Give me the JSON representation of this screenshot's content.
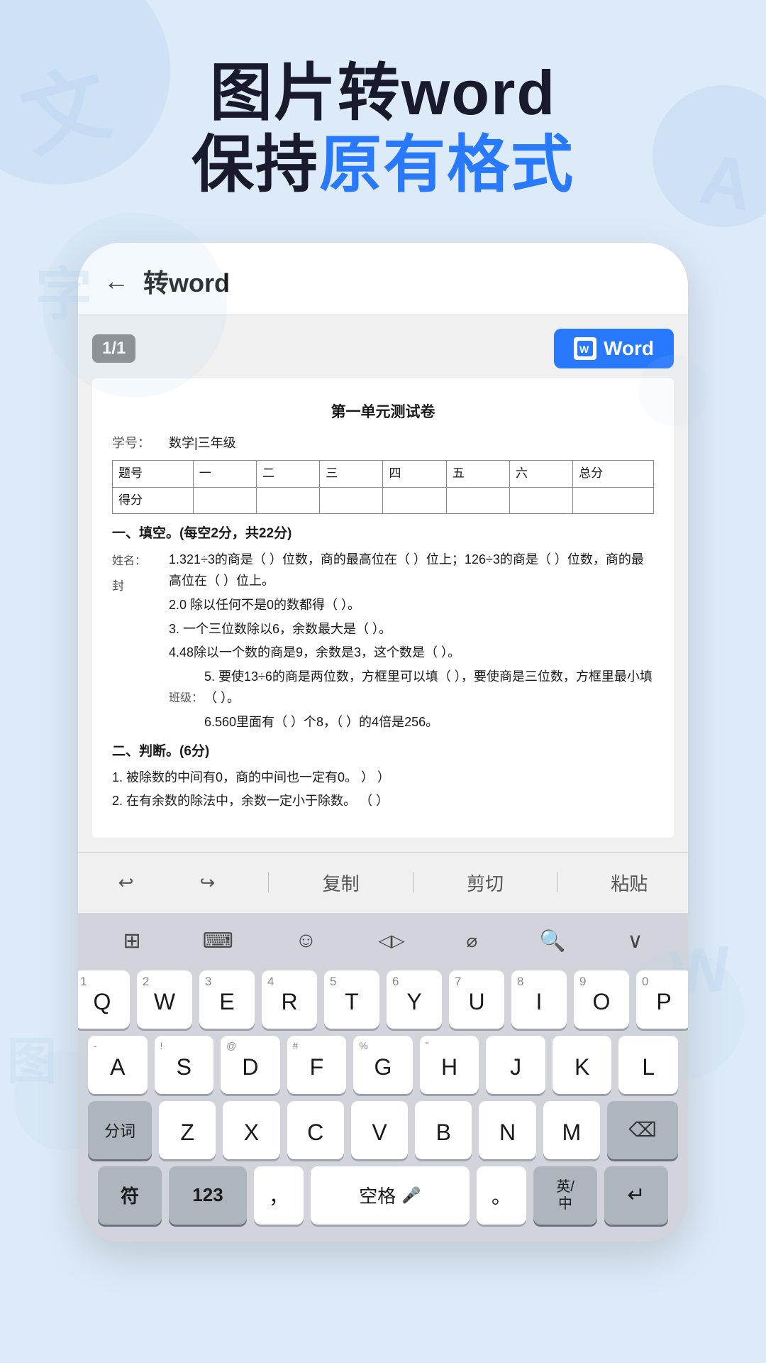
{
  "header": {
    "line1": "图片转word",
    "line2_prefix": "保持",
    "line2_blue": "原有格式",
    "line2_suffix": ""
  },
  "app": {
    "back_label": "←",
    "title": "转word",
    "page_indicator": "1/1",
    "word_button_label": "Word"
  },
  "document": {
    "title": "第一单元测试卷",
    "info_xue_hao": "数学|三年级",
    "table_headers": [
      "题号",
      "一",
      "二",
      "三",
      "四",
      "五",
      "六",
      "总分"
    ],
    "table_row2": [
      "得分",
      "",
      "",
      "",
      "",
      "",
      "",
      ""
    ],
    "section1_title": "一、填空。(每空2分，共22分)",
    "q1": "1.321÷3的商是（ ）位数，商的最高位在（ ）位上；126÷3的商是（ ）位数，商的最高位在（ ）位上。",
    "q2": "2.0 除以任何不是0的数都得（ ）。",
    "q3": "3. 一个三位数除以6，余数最大是（ ）。",
    "q4": "4.48除以一个数的商是9，余数是3，这个数是（ ）。",
    "q5": "5. 要使13÷6的商是两位数，方框里可以填（ ），要使商是三位数，方框里最小填（ ）。",
    "q6": "6.560里面有（ ）个8，（ ）的4倍是256。",
    "section2_title": "二、判断。(6分)",
    "j1": "1. 被除数的中间有0，商的中间也一定有0。   ）            ）",
    "j2": "2. 在有余数的除法中，余数一定小于除数。   （ ）",
    "姓名_label": "姓名：",
    "姓名_val": "封",
    "班级_label": "班级："
  },
  "edit_toolbar": {
    "undo": "↩",
    "redo": "↪",
    "copy": "复制",
    "cut": "剪切",
    "paste": "粘贴"
  },
  "keyboard": {
    "top_row": [
      "⊞",
      "⌨",
      "☺",
      "◁▷",
      "⌀",
      "🔍",
      "∨"
    ],
    "row1_nums": [
      "1",
      "2",
      "3",
      "4",
      "5",
      "6",
      "7",
      "8",
      "9",
      "0"
    ],
    "row1_letters": [
      "Q",
      "W",
      "E",
      "R",
      "T",
      "Y",
      "U",
      "I",
      "O",
      "P"
    ],
    "row1_subs": [
      "-",
      "!",
      "@",
      "#",
      "%",
      "\"",
      "&",
      "",
      "",
      "/"
    ],
    "row2_letters": [
      "A",
      "S",
      "D",
      "F",
      "G",
      "H",
      "J",
      "K",
      "L"
    ],
    "row2_subs": [
      "",
      "",
      "",
      "",
      "",
      "",
      "",
      "",
      ""
    ],
    "row3_letters": [
      "Z",
      "X",
      "C",
      "V",
      "B",
      "N",
      "M"
    ],
    "row3_subs": [
      "",
      "",
      "",
      "",
      "",
      "",
      ""
    ],
    "split_word_label": "分词",
    "sym_label": "符",
    "num_label": "123",
    "comma": "，",
    "space_label": "空格",
    "mic_label": "🎤",
    "dot": "。",
    "lang_label": "英/\n中",
    "enter_label": "↵",
    "delete_label": "⌫"
  }
}
